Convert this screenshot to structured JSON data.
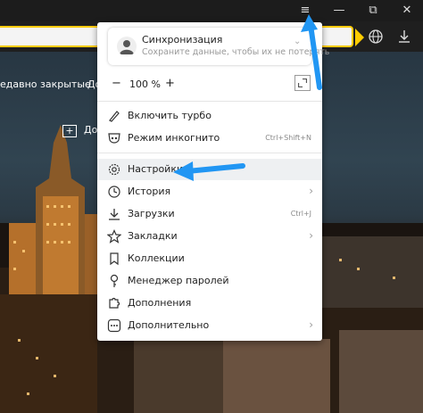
{
  "toolbar": {
    "menu_icon": "hamburger-icon",
    "minimize_icon": "minimize-icon",
    "restore_icon": "restore-icon",
    "close_icon": "close-icon",
    "menu_glyph": "≡",
    "minimize_glyph": "—",
    "restore_glyph": "⧉",
    "close_glyph": "✕"
  },
  "bookmarks": {
    "item1": "едавно закрытые",
    "item2": "До",
    "add_label": "До"
  },
  "menu": {
    "sync": {
      "title": "Синхронизация",
      "subtitle": "Сохраните данные, чтобы их не потерять"
    },
    "zoom": {
      "minus": "−",
      "value": "100 %",
      "plus": "+"
    },
    "items": [
      {
        "label": "Включить турбо",
        "icon": "rocket-icon",
        "shortcut": ""
      },
      {
        "label": "Режим инкогнито",
        "icon": "incognito-icon",
        "shortcut": "Ctrl+Shift+N"
      },
      {
        "label": "Настройки",
        "icon": "gear-icon",
        "shortcut": ""
      },
      {
        "label": "История",
        "icon": "clock-icon",
        "shortcut": "",
        "arrow": "›"
      },
      {
        "label": "Загрузки",
        "icon": "download-icon",
        "shortcut": "Ctrl+J"
      },
      {
        "label": "Закладки",
        "icon": "star-icon",
        "shortcut": "",
        "arrow": "›"
      },
      {
        "label": "Коллекции",
        "icon": "bookmark-icon",
        "shortcut": ""
      },
      {
        "label": "Менеджер паролей",
        "icon": "key-icon",
        "shortcut": ""
      },
      {
        "label": "Дополнения",
        "icon": "puzzle-icon",
        "shortcut": ""
      },
      {
        "label": "Дополнительно",
        "icon": "more-icon",
        "shortcut": "",
        "arrow": "›"
      }
    ]
  },
  "colors": {
    "accent_yellow": "#ffcc00",
    "annotation_blue": "#2196f3",
    "menu_highlight": "#eef0f2"
  }
}
